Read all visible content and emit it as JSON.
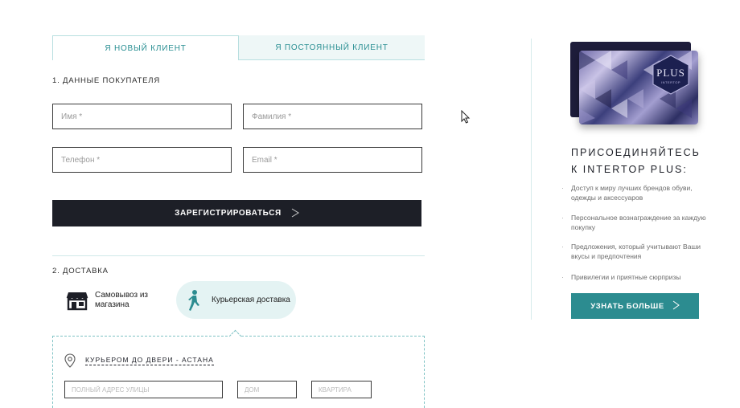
{
  "tabs": {
    "new_client": "Я НОВЫЙ КЛИЕНТ",
    "regular_client": "Я ПОСТОЯННЫЙ КЛИЕНТ"
  },
  "section1": {
    "title": "1. ДАННЫЕ ПОКУПАТЕЛЯ",
    "first_name_placeholder": "Имя *",
    "last_name_placeholder": "Фамилия *",
    "phone_placeholder": "Телефон *",
    "email_placeholder": "Email *",
    "register_label": "ЗАРЕГИСТРИРОВАТЬСЯ",
    "arrow": ">"
  },
  "section2": {
    "title": "2. ДОСТАВКА",
    "pickup_label_line1": "Самовывоз из",
    "pickup_label_line2": "магазина",
    "courier_label": "Курьерская доставка",
    "courier_to_door": "КУРЬЕРОМ ДО ДВЕРИ - АСТАНА",
    "partial_field1": "ПОЛНЫЙ АДРЕС УЛИЦЫ",
    "partial_field2": "ДОМ",
    "partial_field3": "КВАРТИРА"
  },
  "promo": {
    "card_logo": "PLUS",
    "card_sub": "INTERTOP",
    "title_line1": "ПРИСОЕДИНЯЙТЕСЬ",
    "title_line2": "К INTERTOP PLUS:",
    "benefits": [
      "Доступ к миру лучших брендов обуви, одежды и аксессуаров",
      "Персональное вознаграждение за каждую покупку",
      "Предложения, который учитывают Ваши вкусы и предпочтения",
      "Привилегии и приятные сюрпризы"
    ],
    "more_label": "УЗНАТЬ БОЛЬШЕ",
    "arrow": ">"
  },
  "colors": {
    "accent": "#2c8c90",
    "dark_button": "#1d1f27",
    "tab_text": "#2a8f93",
    "courier_bg": "#e4f3f3"
  }
}
